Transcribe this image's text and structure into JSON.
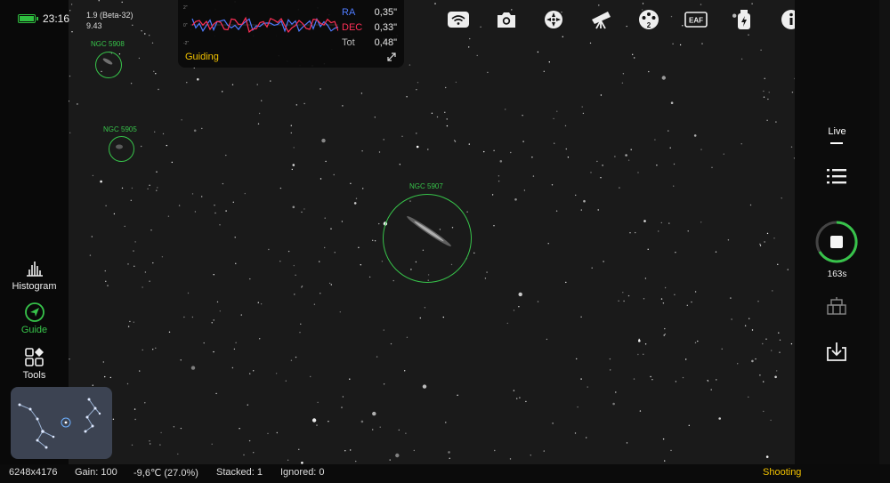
{
  "status": {
    "time": "23:16"
  },
  "app": {
    "version_line1": "1.9 (Beta-32)",
    "version_line2": "9.43"
  },
  "guiding": {
    "title": "Guiding",
    "axis_top": "2\"",
    "axis_mid": "0\"",
    "axis_bot": "-2\"",
    "ra_label": "RA",
    "ra_value": "0,35\"",
    "dec_label": "DEC",
    "dec_value": "0,33\"",
    "tot_label": "Tot",
    "tot_value": "0,48\"",
    "colors": {
      "ra": "#4f7bff",
      "dec": "#ff2f56"
    }
  },
  "toolbar": [
    "wifi-icon",
    "camera-icon",
    "focuser-icon",
    "telescope-icon",
    "filter-wheel-icon",
    "eaf-icon",
    "power-icon",
    "info-icon"
  ],
  "toolbar_labels": {
    "filter_wheel_badge": "2",
    "eaf_text": "EAF"
  },
  "left_rail": {
    "histogram": "Histogram",
    "guide": "Guide",
    "tools": "Tools"
  },
  "right_rail": {
    "live": "Live",
    "exposure_remaining": "163s"
  },
  "objects": [
    {
      "name": "NGC 5908"
    },
    {
      "name": "NGC 5905"
    },
    {
      "name": "NGC 5907"
    }
  ],
  "bottom": {
    "resolution": "6248x4176",
    "gain": "Gain: 100",
    "temperature": "-9,6℃ (27.0%)",
    "stacked": "Stacked: 1",
    "ignored": "Ignored: 0",
    "state": "Shooting"
  },
  "accent": {
    "green": "#37c34a",
    "yellow": "#f2c200"
  }
}
